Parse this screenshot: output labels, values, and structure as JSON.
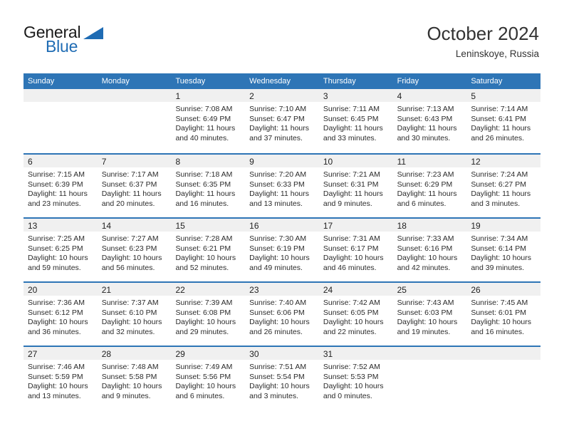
{
  "brand": {
    "name_top": "General",
    "name_bottom": "Blue",
    "triangle_color": "#1f6cb4",
    "text_color": "#1a1a1a"
  },
  "header": {
    "title": "October 2024",
    "subtitle": "Leninskoye, Russia"
  },
  "theme": {
    "header_blue": "#2e75b6",
    "daynum_band": "#f0f0f0",
    "cell_background": "#ffffff",
    "text": "#2b2b2b"
  },
  "calendar": {
    "weekdays": [
      "Sunday",
      "Monday",
      "Tuesday",
      "Wednesday",
      "Thursday",
      "Friday",
      "Saturday"
    ],
    "weeks": [
      [
        {
          "day": "",
          "lines": []
        },
        {
          "day": "",
          "lines": []
        },
        {
          "day": "1",
          "lines": [
            "Sunrise: 7:08 AM",
            "Sunset: 6:49 PM",
            "Daylight: 11 hours",
            "and 40 minutes."
          ]
        },
        {
          "day": "2",
          "lines": [
            "Sunrise: 7:10 AM",
            "Sunset: 6:47 PM",
            "Daylight: 11 hours",
            "and 37 minutes."
          ]
        },
        {
          "day": "3",
          "lines": [
            "Sunrise: 7:11 AM",
            "Sunset: 6:45 PM",
            "Daylight: 11 hours",
            "and 33 minutes."
          ]
        },
        {
          "day": "4",
          "lines": [
            "Sunrise: 7:13 AM",
            "Sunset: 6:43 PM",
            "Daylight: 11 hours",
            "and 30 minutes."
          ]
        },
        {
          "day": "5",
          "lines": [
            "Sunrise: 7:14 AM",
            "Sunset: 6:41 PM",
            "Daylight: 11 hours",
            "and 26 minutes."
          ]
        }
      ],
      [
        {
          "day": "6",
          "lines": [
            "Sunrise: 7:15 AM",
            "Sunset: 6:39 PM",
            "Daylight: 11 hours",
            "and 23 minutes."
          ]
        },
        {
          "day": "7",
          "lines": [
            "Sunrise: 7:17 AM",
            "Sunset: 6:37 PM",
            "Daylight: 11 hours",
            "and 20 minutes."
          ]
        },
        {
          "day": "8",
          "lines": [
            "Sunrise: 7:18 AM",
            "Sunset: 6:35 PM",
            "Daylight: 11 hours",
            "and 16 minutes."
          ]
        },
        {
          "day": "9",
          "lines": [
            "Sunrise: 7:20 AM",
            "Sunset: 6:33 PM",
            "Daylight: 11 hours",
            "and 13 minutes."
          ]
        },
        {
          "day": "10",
          "lines": [
            "Sunrise: 7:21 AM",
            "Sunset: 6:31 PM",
            "Daylight: 11 hours",
            "and 9 minutes."
          ]
        },
        {
          "day": "11",
          "lines": [
            "Sunrise: 7:23 AM",
            "Sunset: 6:29 PM",
            "Daylight: 11 hours",
            "and 6 minutes."
          ]
        },
        {
          "day": "12",
          "lines": [
            "Sunrise: 7:24 AM",
            "Sunset: 6:27 PM",
            "Daylight: 11 hours",
            "and 3 minutes."
          ]
        }
      ],
      [
        {
          "day": "13",
          "lines": [
            "Sunrise: 7:25 AM",
            "Sunset: 6:25 PM",
            "Daylight: 10 hours",
            "and 59 minutes."
          ]
        },
        {
          "day": "14",
          "lines": [
            "Sunrise: 7:27 AM",
            "Sunset: 6:23 PM",
            "Daylight: 10 hours",
            "and 56 minutes."
          ]
        },
        {
          "day": "15",
          "lines": [
            "Sunrise: 7:28 AM",
            "Sunset: 6:21 PM",
            "Daylight: 10 hours",
            "and 52 minutes."
          ]
        },
        {
          "day": "16",
          "lines": [
            "Sunrise: 7:30 AM",
            "Sunset: 6:19 PM",
            "Daylight: 10 hours",
            "and 49 minutes."
          ]
        },
        {
          "day": "17",
          "lines": [
            "Sunrise: 7:31 AM",
            "Sunset: 6:17 PM",
            "Daylight: 10 hours",
            "and 46 minutes."
          ]
        },
        {
          "day": "18",
          "lines": [
            "Sunrise: 7:33 AM",
            "Sunset: 6:16 PM",
            "Daylight: 10 hours",
            "and 42 minutes."
          ]
        },
        {
          "day": "19",
          "lines": [
            "Sunrise: 7:34 AM",
            "Sunset: 6:14 PM",
            "Daylight: 10 hours",
            "and 39 minutes."
          ]
        }
      ],
      [
        {
          "day": "20",
          "lines": [
            "Sunrise: 7:36 AM",
            "Sunset: 6:12 PM",
            "Daylight: 10 hours",
            "and 36 minutes."
          ]
        },
        {
          "day": "21",
          "lines": [
            "Sunrise: 7:37 AM",
            "Sunset: 6:10 PM",
            "Daylight: 10 hours",
            "and 32 minutes."
          ]
        },
        {
          "day": "22",
          "lines": [
            "Sunrise: 7:39 AM",
            "Sunset: 6:08 PM",
            "Daylight: 10 hours",
            "and 29 minutes."
          ]
        },
        {
          "day": "23",
          "lines": [
            "Sunrise: 7:40 AM",
            "Sunset: 6:06 PM",
            "Daylight: 10 hours",
            "and 26 minutes."
          ]
        },
        {
          "day": "24",
          "lines": [
            "Sunrise: 7:42 AM",
            "Sunset: 6:05 PM",
            "Daylight: 10 hours",
            "and 22 minutes."
          ]
        },
        {
          "day": "25",
          "lines": [
            "Sunrise: 7:43 AM",
            "Sunset: 6:03 PM",
            "Daylight: 10 hours",
            "and 19 minutes."
          ]
        },
        {
          "day": "26",
          "lines": [
            "Sunrise: 7:45 AM",
            "Sunset: 6:01 PM",
            "Daylight: 10 hours",
            "and 16 minutes."
          ]
        }
      ],
      [
        {
          "day": "27",
          "lines": [
            "Sunrise: 7:46 AM",
            "Sunset: 5:59 PM",
            "Daylight: 10 hours",
            "and 13 minutes."
          ]
        },
        {
          "day": "28",
          "lines": [
            "Sunrise: 7:48 AM",
            "Sunset: 5:58 PM",
            "Daylight: 10 hours",
            "and 9 minutes."
          ]
        },
        {
          "day": "29",
          "lines": [
            "Sunrise: 7:49 AM",
            "Sunset: 5:56 PM",
            "Daylight: 10 hours",
            "and 6 minutes."
          ]
        },
        {
          "day": "30",
          "lines": [
            "Sunrise: 7:51 AM",
            "Sunset: 5:54 PM",
            "Daylight: 10 hours",
            "and 3 minutes."
          ]
        },
        {
          "day": "31",
          "lines": [
            "Sunrise: 7:52 AM",
            "Sunset: 5:53 PM",
            "Daylight: 10 hours",
            "and 0 minutes."
          ]
        },
        {
          "day": "",
          "lines": []
        },
        {
          "day": "",
          "lines": []
        }
      ]
    ]
  }
}
